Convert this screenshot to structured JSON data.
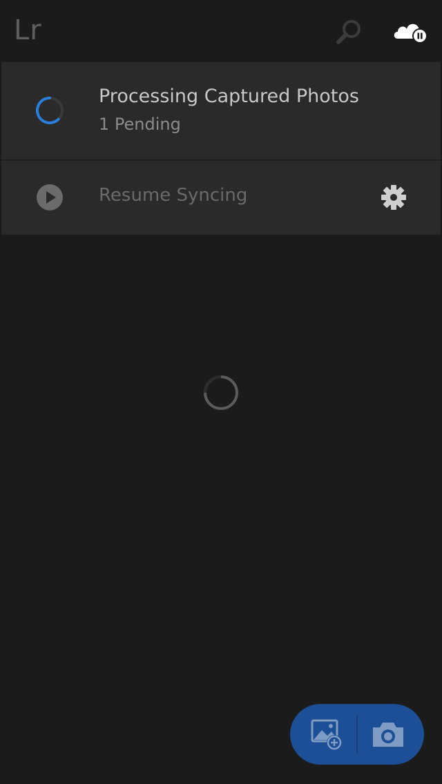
{
  "header": {
    "logo_text": "Lr",
    "search_icon": "search-icon",
    "cloud_icon": "cloud-paused-icon"
  },
  "sync_panel": {
    "processing": {
      "title": "Processing Captured Photos",
      "subtitle": "1 Pending",
      "icon": "progress-spinner-icon"
    },
    "resume": {
      "label": "Resume Syncing",
      "play_icon": "play-icon",
      "settings_icon": "gear-icon"
    }
  },
  "main": {
    "loader_icon": "loading-spinner-icon"
  },
  "fab": {
    "add_icon": "add-photo-icon",
    "camera_icon": "camera-icon"
  },
  "colors": {
    "background": "#1b1b1b",
    "panel": "#2a2a2a",
    "accent_blue": "#2a7fdd",
    "fab_blue": "#1c4f96"
  }
}
